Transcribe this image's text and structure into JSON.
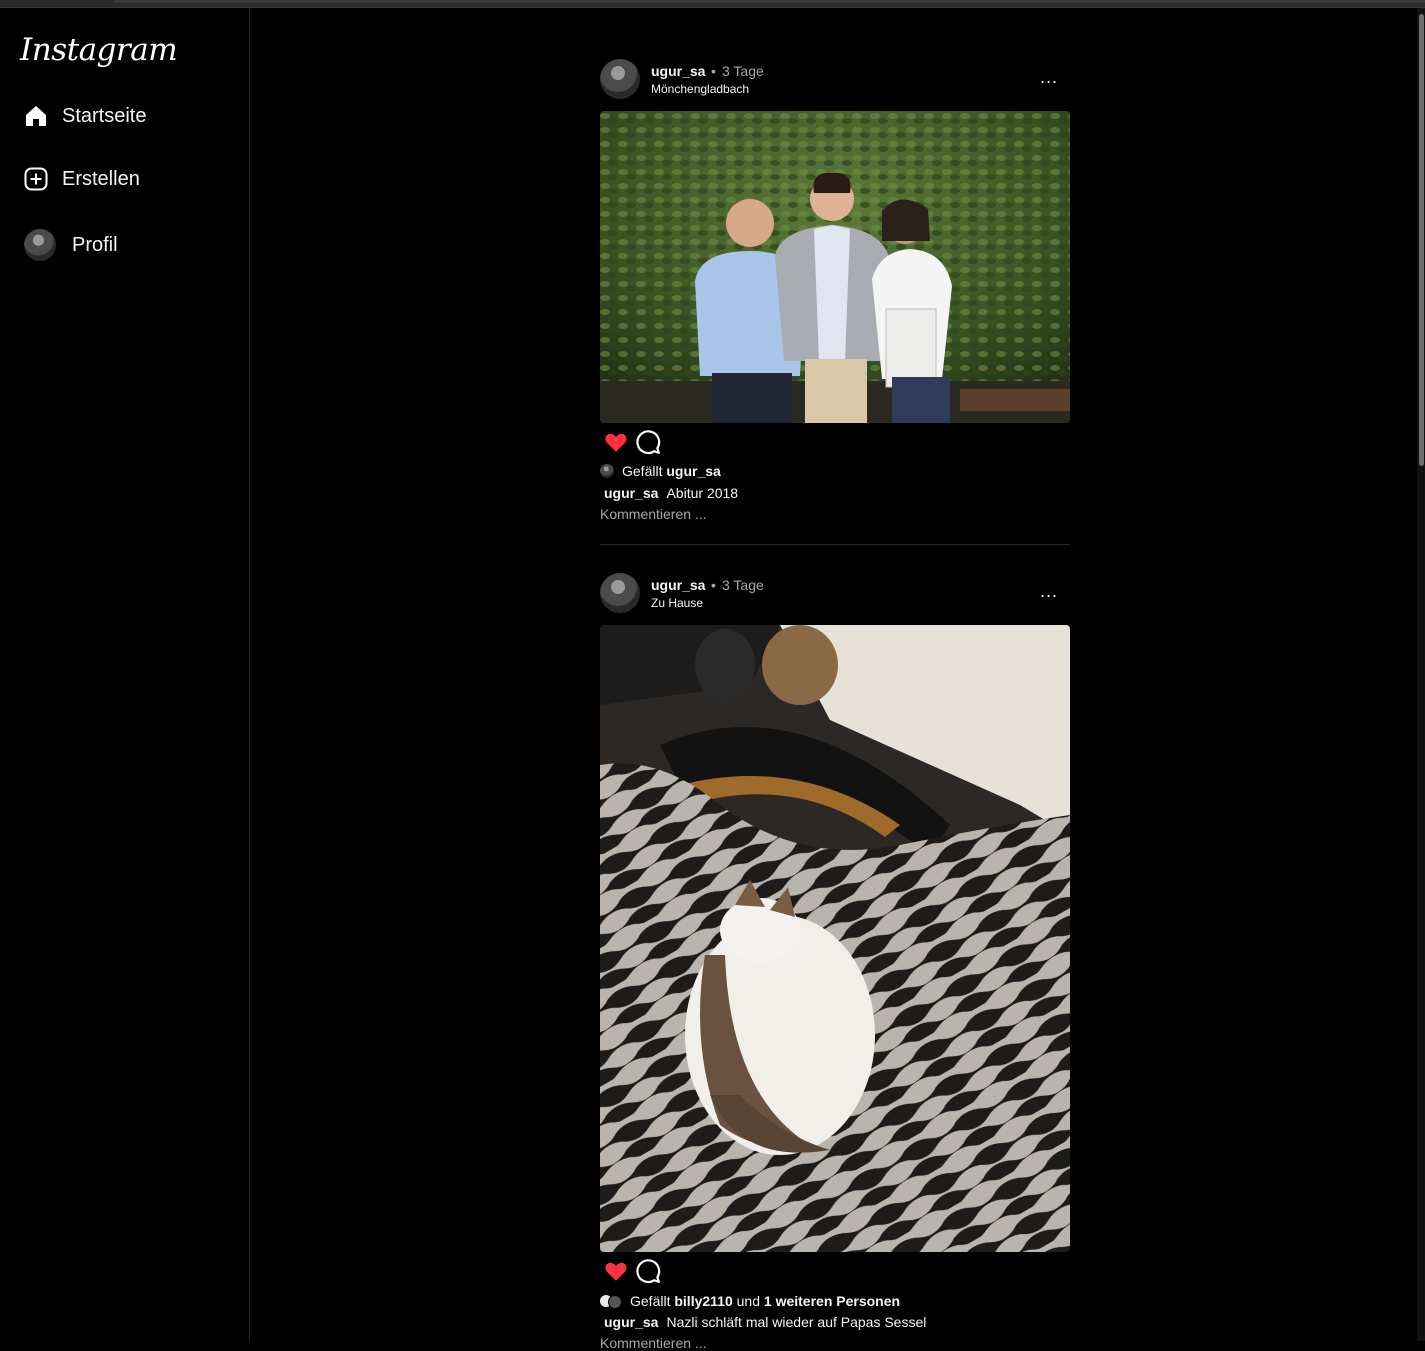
{
  "brand": {
    "logo_text": "Instagram"
  },
  "sidebar": {
    "items": [
      {
        "label": "Startseite",
        "icon": "home-icon"
      },
      {
        "label": "Erstellen",
        "icon": "plus-square-icon"
      },
      {
        "label": "Profil",
        "icon": "avatar"
      }
    ]
  },
  "posts": [
    {
      "username": "ugur_sa",
      "separator": "•",
      "time": "3 Tage",
      "location": "Mönchengladbach",
      "more": "...",
      "liked": true,
      "likes": {
        "prefix": "Gefällt",
        "user": "ugur_sa",
        "connector": "",
        "others": ""
      },
      "caption_user": "ugur_sa",
      "caption": "Abitur 2018",
      "comment_placeholder": "Kommentieren ..."
    },
    {
      "username": "ugur_sa",
      "separator": "•",
      "time": "3 Tage",
      "location": "Zu Hause",
      "more": "...",
      "liked": true,
      "likes": {
        "prefix": "Gefällt",
        "user": "billy2110",
        "connector": "und",
        "others": "1 weiteren Personen"
      },
      "caption_user": "ugur_sa",
      "caption": "Nazli schläft mal wieder auf Papas Sessel",
      "comment_placeholder": "Kommentieren ..."
    }
  ],
  "colors": {
    "background": "#000000",
    "heart": "#ff3040",
    "muted_text": "#a8a8a8",
    "divider": "#262626"
  }
}
